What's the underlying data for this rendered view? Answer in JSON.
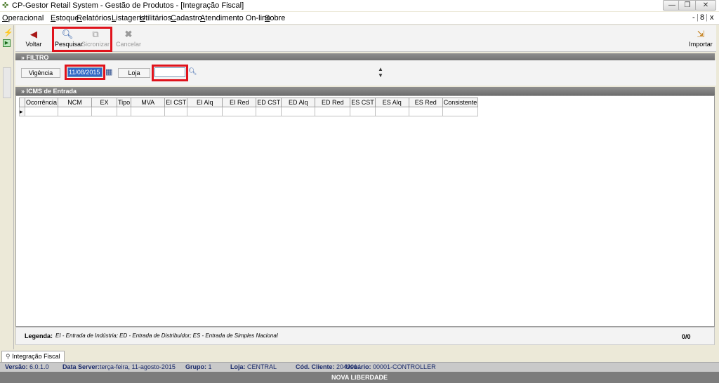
{
  "window": {
    "title": "CP-Gestor Retail System - Gestão de Produtos - [Integração Fiscal]",
    "minimize": "—",
    "restore": "❐",
    "close": "✕"
  },
  "menubar": {
    "items": [
      {
        "first": "O",
        "rest": "peracional"
      },
      {
        "first": "E",
        "rest": "stoque"
      },
      {
        "first": "R",
        "rest": "elatórios"
      },
      {
        "first": "L",
        "rest": "istagens"
      },
      {
        "first": "U",
        "rest": "tilitários"
      },
      {
        "first": "C",
        "rest": "adastro"
      },
      {
        "first": "A",
        "rest": "tendimento On-line"
      },
      {
        "first": "S",
        "rest": "obre"
      }
    ],
    "mdi_controls": [
      "-",
      "|",
      "8",
      "|",
      "x"
    ]
  },
  "toolbar": {
    "voltar": "Voltar",
    "pesquisar": "Pesquisar",
    "sicronizar": "Sicronizar",
    "cancelar": "Cancelar",
    "importar": "Importar"
  },
  "filter": {
    "header": "» FILTRO",
    "vigencia_label": "Vigência",
    "vigencia_value": "11/08/2015",
    "loja_label": "Loja",
    "loja_value": ""
  },
  "grid": {
    "header": "» ICMS de Entrada",
    "columns": [
      "Ocorrência",
      "NCM",
      "EX",
      "Tipo",
      "MVA",
      "EI CST",
      "EI Alq",
      "EI Red",
      "ED CST",
      "ED Alq",
      "ED Red",
      "ES CST",
      "ES Alq",
      "ES Red",
      "Consistente"
    ]
  },
  "legend": {
    "label": "Legenda",
    "text": "EI - Entrada de Indústria;  ED - Entrada de Distribuidor;  ES - Entrada de Simples Nacional",
    "count": "0/0"
  },
  "doc_tab": "Integração Fiscal",
  "status": {
    "versao_label": "Versão:",
    "versao": "6.0.1.0",
    "data_server_label": "Data Server:",
    "data_server": "terça-feira, 11-agosto-2015",
    "grupo_label": "Grupo:",
    "grupo": "1",
    "loja_label": "Loja:",
    "loja": "CENTRAL",
    "cod_cliente_label": "Cód. Cliente:",
    "cod_cliente": "204901",
    "usuario_label": "Usuário:",
    "usuario": "00001-CONTROLLER"
  },
  "footer": "NOVA LIBERDADE",
  "colors": {
    "highlight_red": "#e0131c",
    "selection_blue": "#3169c6",
    "section_gray": "#7c7c7c"
  },
  "icons": {
    "voltar": "arrow-left-icon",
    "pesquisar": "globe-search-icon",
    "sicronizar": "sync-documents-icon",
    "cancelar": "cancel-x-icon",
    "importar": "import-icon",
    "calendar": "calendar-icon",
    "loja_search": "globe-search-icon"
  }
}
